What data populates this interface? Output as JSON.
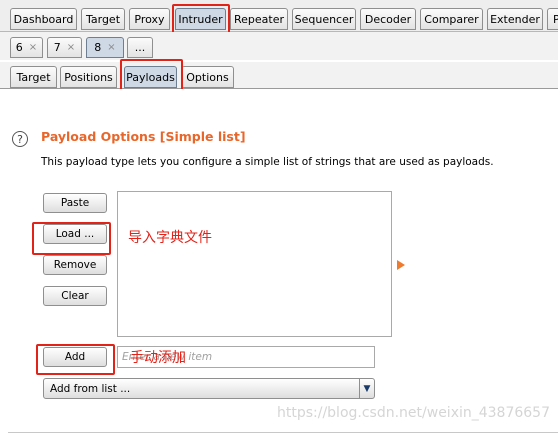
{
  "main_tabs": [
    "Dashboard",
    "Target",
    "Proxy",
    "Intruder",
    "Repeater",
    "Sequencer",
    "Decoder",
    "Comparer",
    "Extender",
    "P"
  ],
  "request_tabs": [
    {
      "label": "6",
      "close": "×"
    },
    {
      "label": "7",
      "close": "×"
    },
    {
      "label": "8",
      "close": "×"
    },
    {
      "label": "..."
    }
  ],
  "sub_tabs": [
    "Target",
    "Positions",
    "Payloads",
    "Options"
  ],
  "section": {
    "help_glyph": "?",
    "title": "Payload Options [Simple list]",
    "description": "This payload type lets you configure a simple list of strings that are used as payloads."
  },
  "buttons": {
    "paste": "Paste",
    "load": "Load ...",
    "remove": "Remove",
    "clear": "Clear",
    "add": "Add"
  },
  "add_input": {
    "value": "",
    "placeholder": "Enter a new item"
  },
  "add_from_list": {
    "selected": "Add from list ..."
  },
  "annotations": {
    "load_note": "导入字典文件",
    "add_note": "手动添加"
  },
  "watermark": "https://blog.csdn.net/weixin_43876657",
  "colors": {
    "accent_orange": "#e8662a",
    "annotation_red": "#e2231a",
    "selected_tab": "#cfd9e6"
  }
}
